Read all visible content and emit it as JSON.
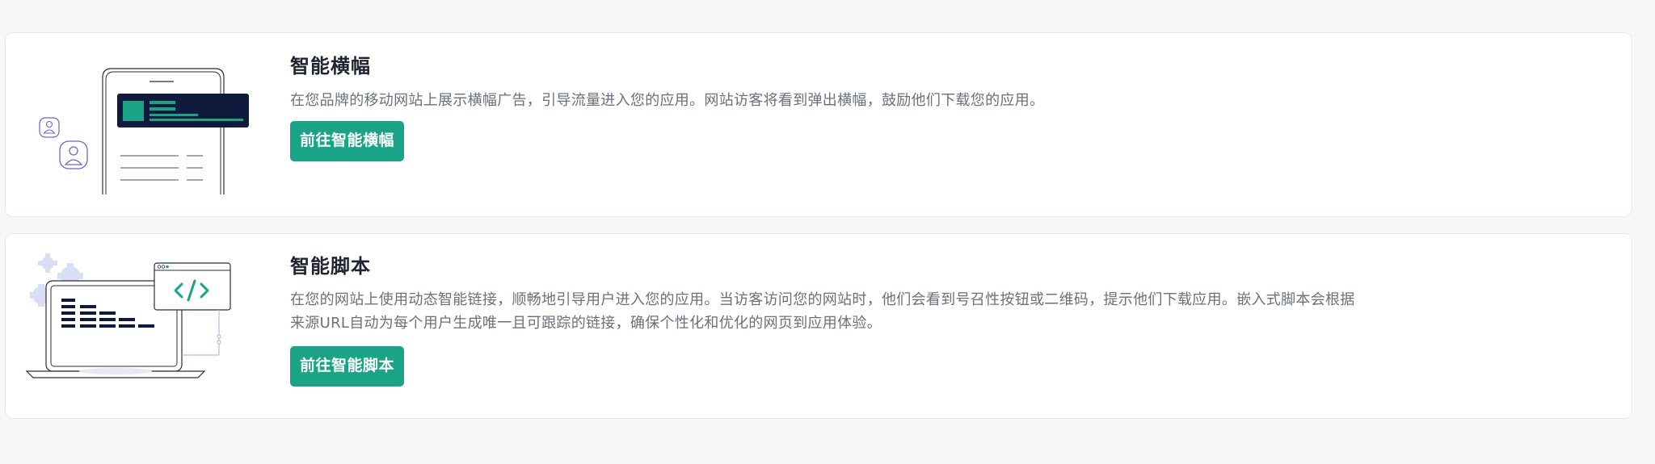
{
  "cards": [
    {
      "title": "智能横幅",
      "description": "在您品牌的移动网站上展示横幅广告，引导流量进入您的应用。网站访客将看到弹出横幅，鼓励他们下载您的应用。",
      "button_label": "前往智能横幅",
      "illustration": "phone-banner-illustration"
    },
    {
      "title": "智能脚本",
      "description": "在您的网站上使用动态智能链接，顺畅地引导用户进入您的应用。当访客访问您的网站时，他们会看到号召性按钮或二维码，提示他们下载应用。嵌入式脚本会根据来源URL自动为每个用户生成唯一且可跟踪的链接，确保个性化和优化的网页到应用体验。",
      "button_label": "前往智能脚本",
      "illustration": "laptop-code-illustration"
    }
  ],
  "colors": {
    "page_background": "#f6f7f9",
    "card_background": "#ffffff",
    "accent": "#1aa386",
    "banner_dark": "#0f1b3d",
    "illustration_purple": "#6d64c8",
    "gear_light": "#d9ddf5"
  }
}
